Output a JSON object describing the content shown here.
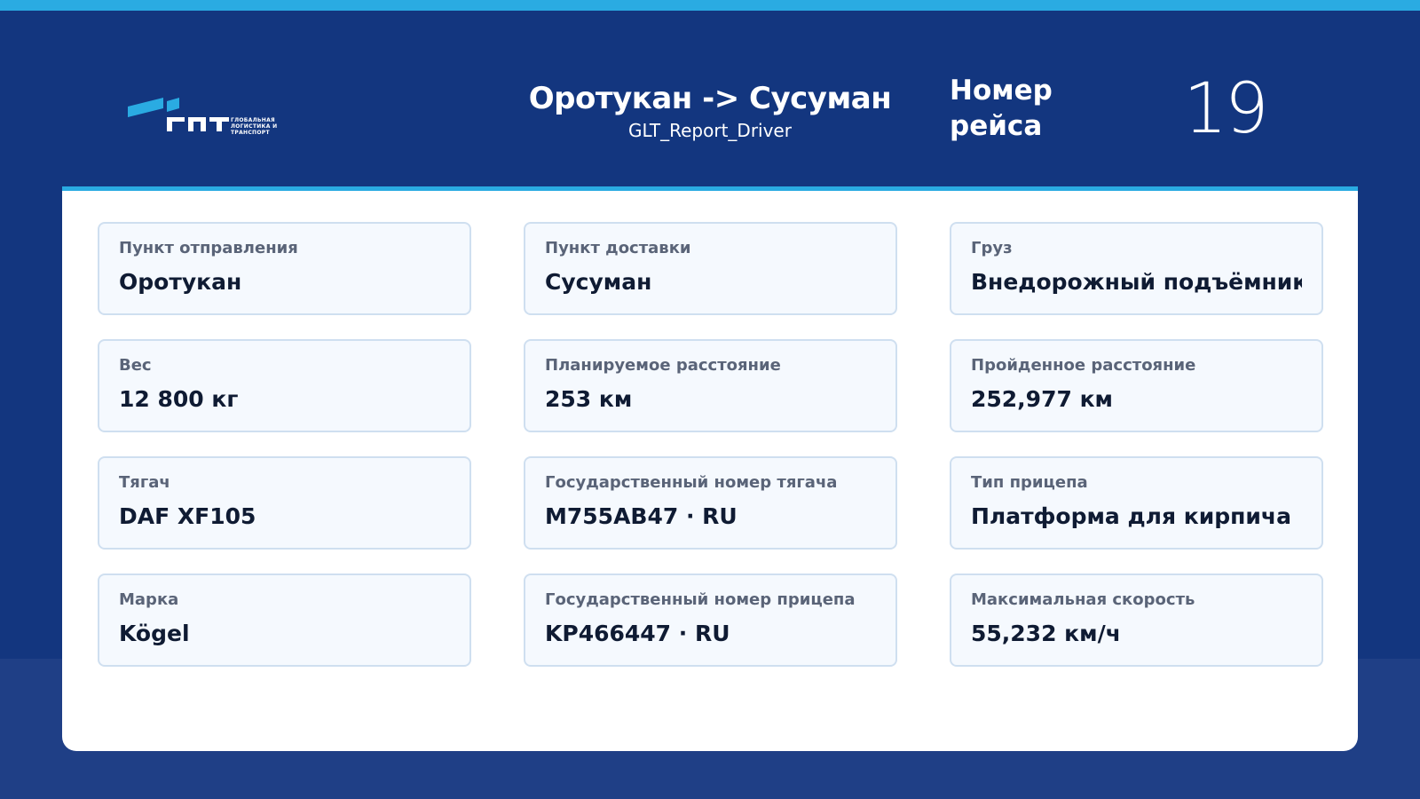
{
  "header": {
    "logo_text": "ГЛОБАЛЬНАЯ ЛОГИСТИКА И ТРАНСПОРТ",
    "route_title": "Оротукан -> Сусуман",
    "report_name": "GLT_Report_Driver",
    "trip_label": "Номер рейса",
    "trip_number": "19"
  },
  "cards": [
    {
      "label": "Пункт отправления",
      "value": "Оротукан"
    },
    {
      "label": "Пункт доставки",
      "value": "Сусуман"
    },
    {
      "label": "Груз",
      "value": "Внедорожный подъёмник"
    },
    {
      "label": "Вес",
      "value": "12 800 кг"
    },
    {
      "label": "Планируемое расстояние",
      "value": "253 км"
    },
    {
      "label": "Пройденное расстояние",
      "value": "252,977 км"
    },
    {
      "label": "Тягач",
      "value": "DAF XF105"
    },
    {
      "label": "Государственный номер тягача",
      "value": "M755AB47 · RU"
    },
    {
      "label": "Тип прицепа",
      "value": "Платформа для кирпича"
    },
    {
      "label": "Марка",
      "value": "Kögel"
    },
    {
      "label": "Государственный номер прицепа",
      "value": "KP466447 · RU"
    },
    {
      "label": "Максимальная скорость",
      "value": "55,232 км/ч"
    }
  ],
  "colors": {
    "background": "#13367f",
    "accent": "#2aabe2",
    "card_bg": "#f5f9fe",
    "card_border": "#cfdff0"
  },
  "icons": {
    "logo": "glt-logo-icon"
  }
}
